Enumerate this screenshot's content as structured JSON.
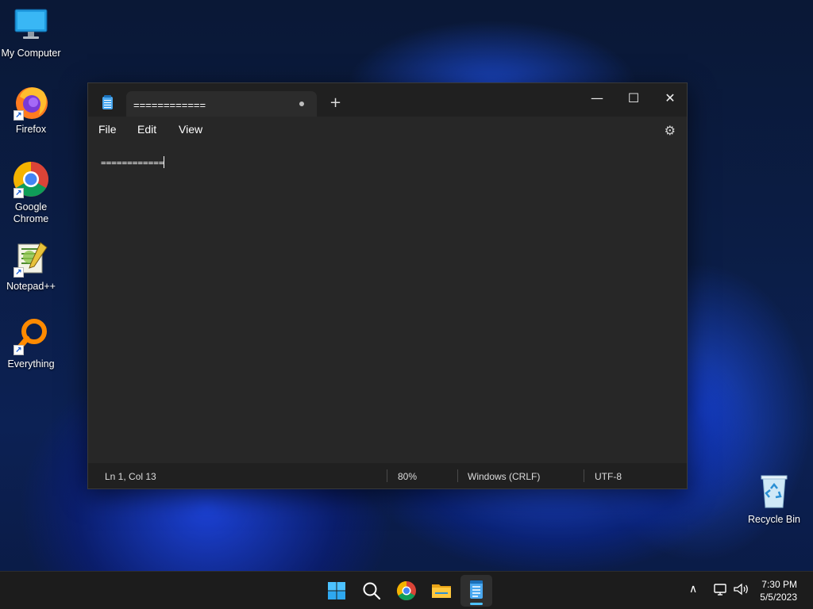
{
  "desktop": {
    "icons": [
      {
        "label": "My Computer",
        "icon": "monitor-icon"
      },
      {
        "label": "Firefox",
        "icon": "firefox-icon"
      },
      {
        "label": "Google Chrome",
        "icon": "chrome-icon"
      },
      {
        "label": "Notepad++",
        "icon": "notepadpp-icon"
      },
      {
        "label": "Everything",
        "icon": "everything-icon"
      },
      {
        "label": "Recycle Bin",
        "icon": "recycle-bin-icon"
      }
    ]
  },
  "notepad": {
    "tab_title": "============",
    "new_tab_symbol": "+",
    "window_controls": {
      "minimize": "—",
      "maximize": "☐",
      "close": "✕"
    },
    "menu": [
      "File",
      "Edit",
      "View"
    ],
    "editor_text": "============",
    "status": {
      "position": "Ln 1, Col 13",
      "zoom": "80%",
      "line_ending": "Windows (CRLF)",
      "encoding": "UTF-8"
    }
  },
  "taskbar": {
    "pinned": [
      "windows-start-icon",
      "search-icon",
      "chrome-icon",
      "file-explorer-icon",
      "notepad-icon"
    ],
    "tray": {
      "chevron": "∧",
      "time": "7:30 PM",
      "date": "5/5/2023"
    }
  },
  "colors": {
    "accent": "#4cc2ff",
    "window_bg": "#272727",
    "titlebar_bg": "#202020",
    "taskbar_bg": "#1c1c1c"
  }
}
